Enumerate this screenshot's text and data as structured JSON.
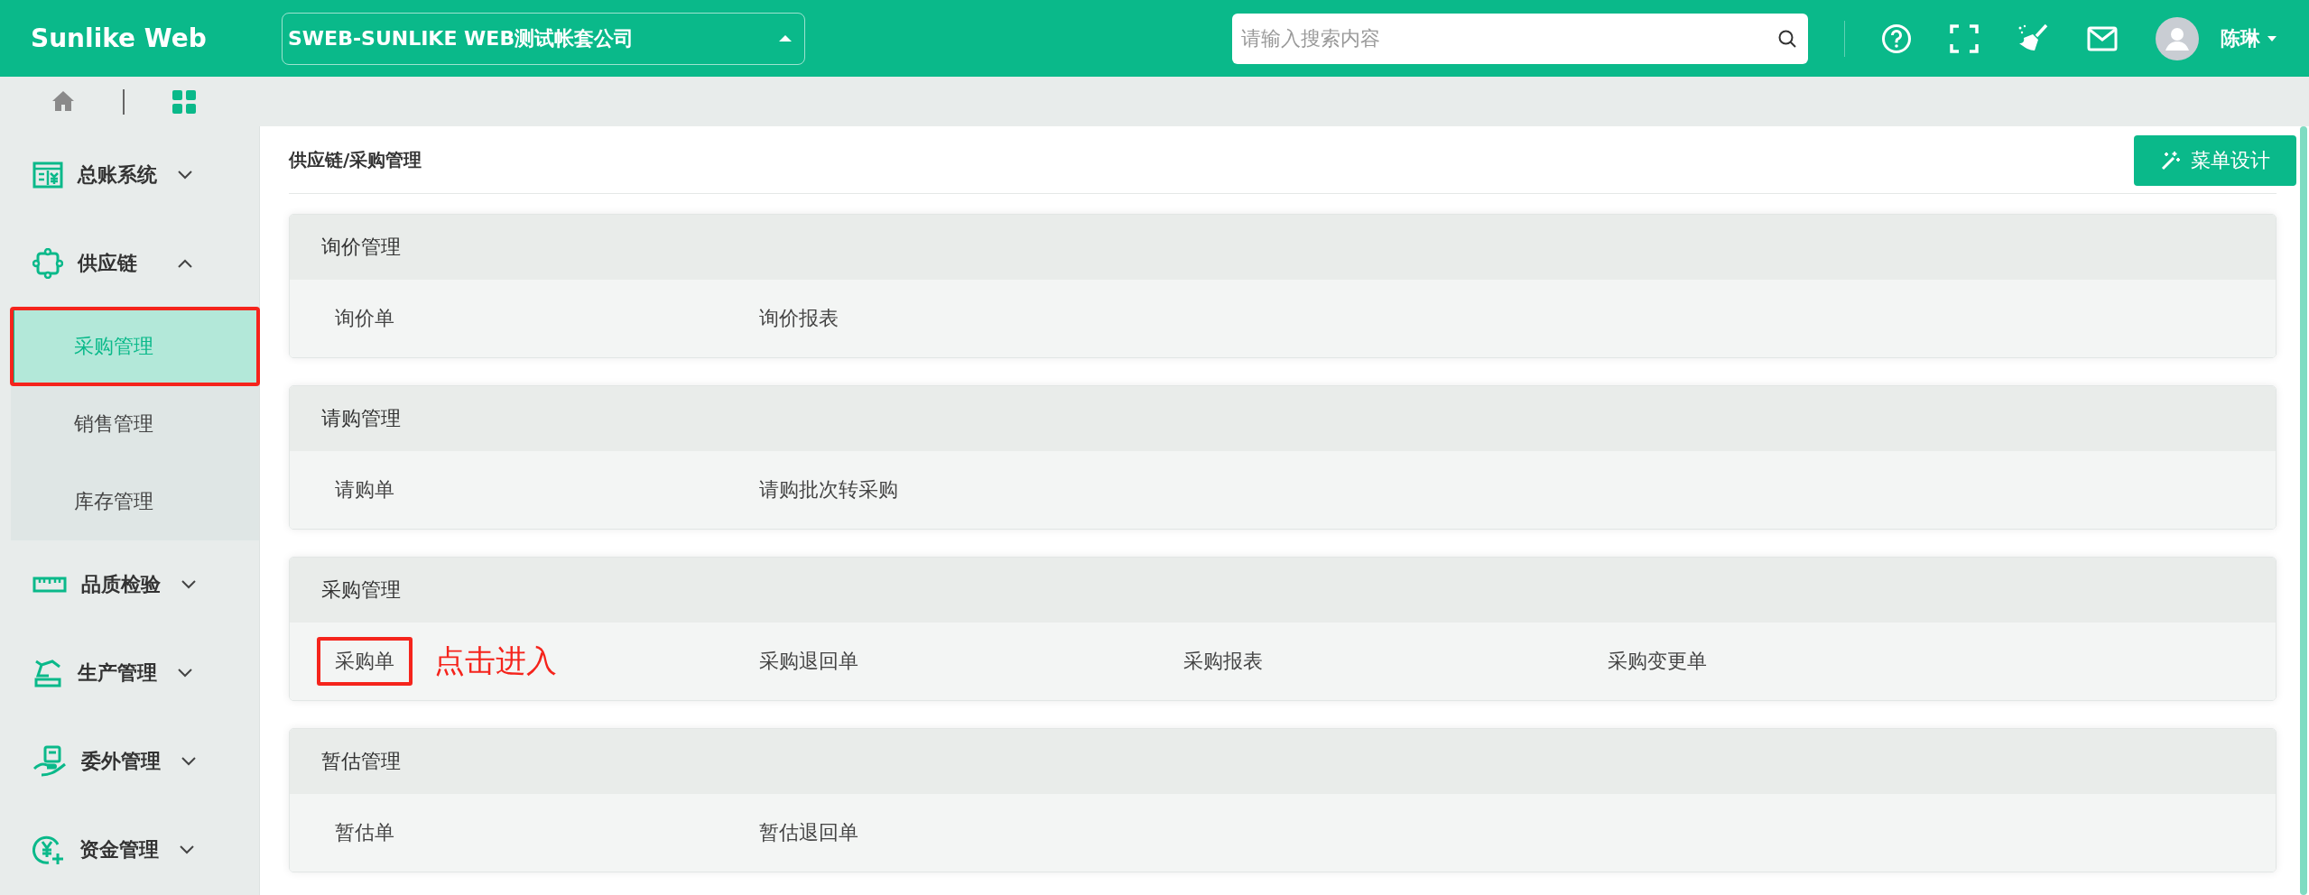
{
  "header": {
    "logo": "Sunlike Web",
    "company": "SWEB-SUNLIKE WEB测试帐套公司",
    "search": {
      "placeholder": "请输入搜索内容"
    },
    "user": "陈琳"
  },
  "nav_tabs": [
    {
      "selected": false
    },
    {
      "selected": true
    }
  ],
  "sidebar": {
    "items": [
      {
        "label": "总账系统",
        "expanded": false
      },
      {
        "label": "供应链",
        "expanded": true,
        "children": [
          {
            "label": "采购管理",
            "selected": true,
            "annotated": true
          },
          {
            "label": "销售管理",
            "selected": false,
            "annotated": false
          },
          {
            "label": "库存管理",
            "selected": false,
            "annotated": false
          }
        ]
      },
      {
        "label": "品质检验",
        "expanded": false
      },
      {
        "label": "生产管理",
        "expanded": false
      },
      {
        "label": "委外管理",
        "expanded": false
      },
      {
        "label": "资金管理",
        "expanded": false
      }
    ]
  },
  "content": {
    "breadcrumb": "供应链/采购管理",
    "design_button": "菜单设计",
    "sections": [
      {
        "title": "询价管理",
        "items": [
          {
            "label": "询价单",
            "annotated": false
          },
          {
            "label": "询价报表",
            "annotated": false
          }
        ]
      },
      {
        "title": "请购管理",
        "items": [
          {
            "label": "请购单",
            "annotated": false
          },
          {
            "label": "请购批次转采购",
            "annotated": false
          }
        ]
      },
      {
        "title": "采购管理",
        "items": [
          {
            "label": "采购单",
            "annotated": true,
            "annotation": "点击进入"
          },
          {
            "label": "采购退回单",
            "annotated": false
          },
          {
            "label": "采购报表",
            "annotated": false
          },
          {
            "label": "采购变更单",
            "annotated": false
          }
        ]
      },
      {
        "title": "暂估管理",
        "items": [
          {
            "label": "暂估单",
            "annotated": false
          },
          {
            "label": "暂估退回单",
            "annotated": false
          }
        ]
      }
    ]
  }
}
